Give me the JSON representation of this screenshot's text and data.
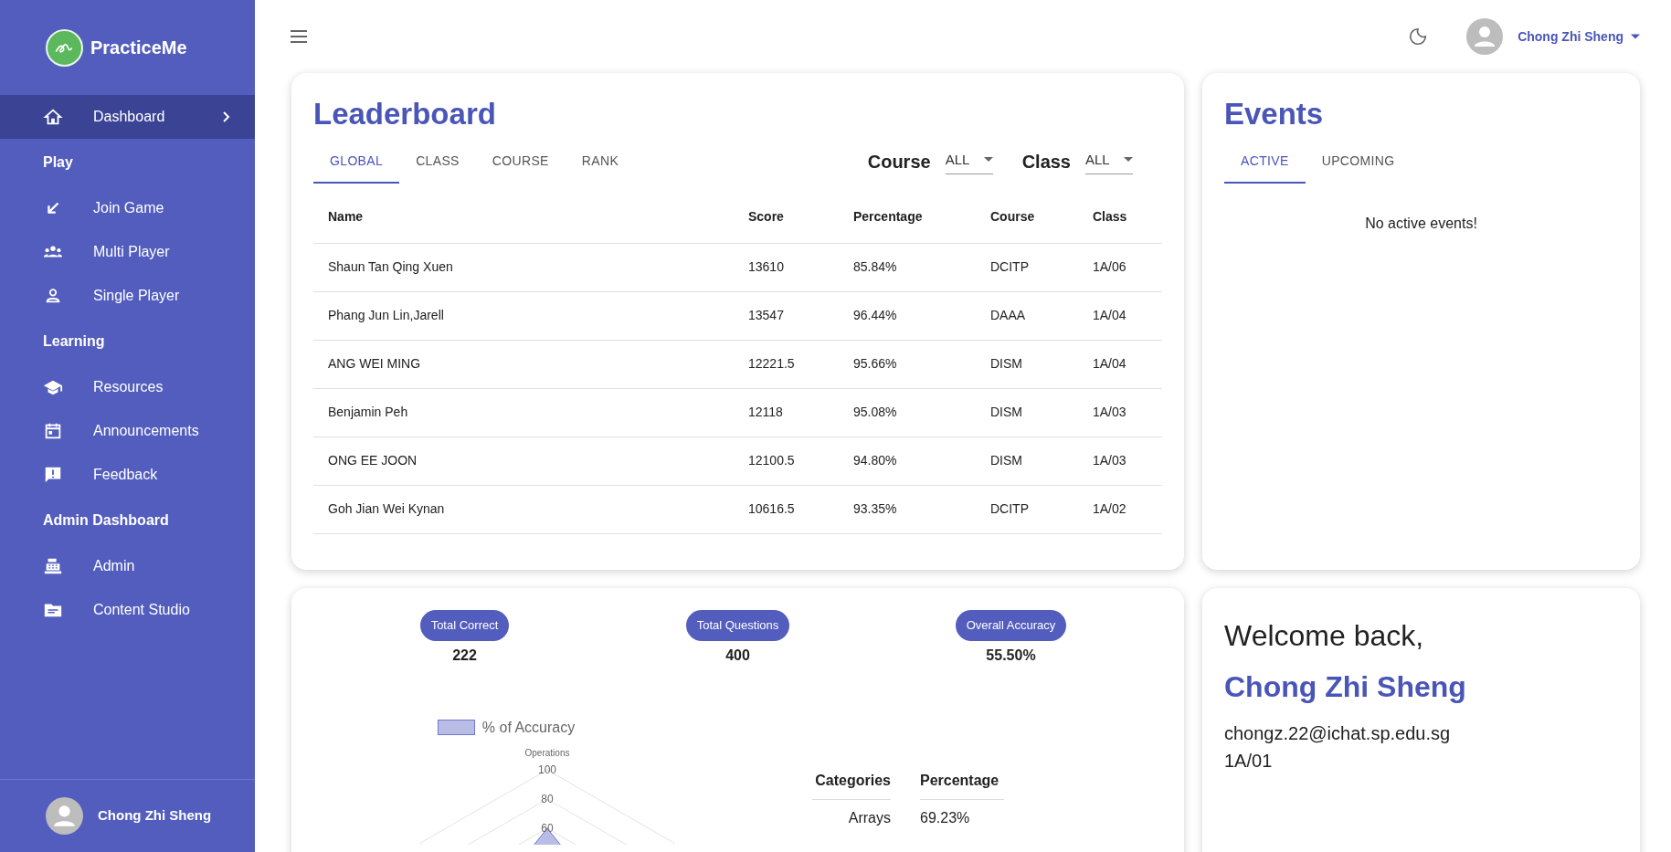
{
  "sidebar": {
    "brand": "PracticeMe",
    "sections": [
      {
        "items": [
          {
            "label": "Dashboard",
            "selected": true
          }
        ]
      },
      {
        "heading": "Play",
        "items": [
          {
            "label": "Join Game",
            "selected": false
          },
          {
            "label": "Multi Player",
            "selected": false
          },
          {
            "label": "Single Player",
            "selected": false
          }
        ]
      },
      {
        "heading": "Learning",
        "items": [
          {
            "label": "Resources",
            "selected": false
          },
          {
            "label": "Announcements",
            "selected": false
          },
          {
            "label": "Feedback",
            "selected": false
          }
        ]
      },
      {
        "heading": "Admin Dashboard",
        "items": [
          {
            "label": "Admin",
            "selected": false
          },
          {
            "label": "Content Studio",
            "selected": false
          }
        ]
      }
    ],
    "user": "Chong Zhi Sheng"
  },
  "topbar": {
    "user": "Chong Zhi Sheng"
  },
  "leaderboard": {
    "title": "Leaderboard",
    "tabs": [
      {
        "label": "GLOBAL",
        "selected": true
      },
      {
        "label": "CLASS",
        "selected": false
      },
      {
        "label": "COURSE",
        "selected": false
      },
      {
        "label": "RANK",
        "selected": false
      }
    ],
    "filters": [
      {
        "label": "Course",
        "value": "ALL"
      },
      {
        "label": "Class",
        "value": "ALL"
      }
    ],
    "columns": [
      "Name",
      "Score",
      "Percentage",
      "Course",
      "Class"
    ],
    "rows": [
      [
        "Shaun Tan Qing Xuen",
        "13610",
        "85.84%",
        "DCITP",
        "1A/06"
      ],
      [
        "Phang Jun Lin,Jarell",
        "13547",
        "96.44%",
        "DAAA",
        "1A/04"
      ],
      [
        "ANG WEI MING",
        "12221.5",
        "95.66%",
        "DISM",
        "1A/04"
      ],
      [
        "Benjamin Peh",
        "12118",
        "95.08%",
        "DISM",
        "1A/03"
      ],
      [
        "ONG EE JOON",
        "12100.5",
        "94.80%",
        "DISM",
        "1A/03"
      ],
      [
        "Goh Jian Wei Kynan",
        "10616.5",
        "93.35%",
        "DCITP",
        "1A/02"
      ]
    ]
  },
  "events": {
    "title": "Events",
    "tabs": [
      {
        "label": "ACTIVE",
        "selected": true
      },
      {
        "label": "UPCOMING",
        "selected": false
      }
    ],
    "empty_message": "No active events!"
  },
  "stats": {
    "items": [
      {
        "label": "Total Correct",
        "value": "222"
      },
      {
        "label": "Total Questions",
        "value": "400"
      },
      {
        "label": "Overall Accuracy",
        "value": "55.50%"
      }
    ],
    "radar": {
      "legend": "% of Accuracy",
      "axis_label": "Operations",
      "ticks": [
        "100",
        "80",
        "60"
      ]
    },
    "categories": {
      "columns": [
        "Categories",
        "Percentage"
      ],
      "rows": [
        [
          "Arrays",
          "69.23%"
        ]
      ]
    }
  },
  "welcome": {
    "greeting": "Welcome back,",
    "name": "Chong Zhi Sheng",
    "email": "chongz.22@ichat.sp.edu.sg",
    "class": "1A/01"
  }
}
